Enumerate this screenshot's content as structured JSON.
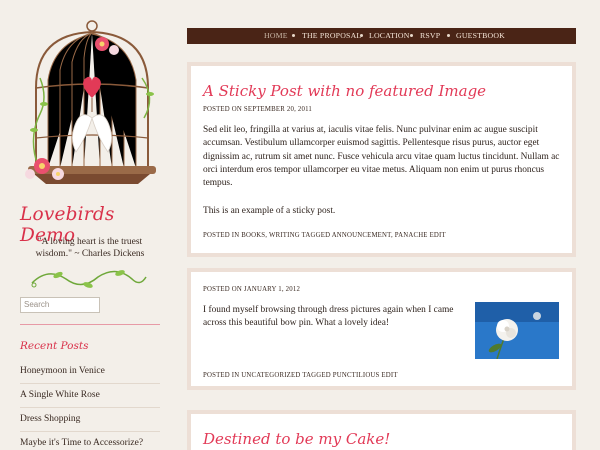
{
  "site": {
    "title": "Lovebirds Demo",
    "tagline": "\"A loving heart is the truest wisdom.\" ~ Charles Dickens"
  },
  "nav": {
    "items": [
      "HOME",
      "THE PROPOSAL",
      "LOCATION",
      "RSVP",
      "GUESTBOOK"
    ]
  },
  "search": {
    "placeholder": "Search"
  },
  "recent": {
    "title": "Recent Posts",
    "items": [
      "Honeymoon in Venice",
      "A Single White Rose",
      "Dress Shopping",
      "Maybe it's Time to Accessorize?"
    ]
  },
  "posts": [
    {
      "title": "A Sticky Post with no featured Image",
      "meta": "POSTED ON SEPTEMBER 20, 2011",
      "lines": [
        "Sed elit leo, fringilla at varius at, iaculis vitae felis. Nunc pulvinar enim ac augue suscipit",
        "accumsan. Vestibulum ullamcorper euismod sagittis. Pellentesque risus purus, auctor eget",
        "dignissim ac, rutrum sit amet nunc. Fusce vehicula arcu vitae quam luctus tincidunt. Nullam ac",
        "orci interdum eros tempor ullamcorper eu vitae metus. Aliquam non enim ut purus rhoncus",
        "tempus."
      ],
      "extra": "This is an example of a sticky post.",
      "footer": "POSTED IN BOOKS, WRITING TAGGED ANNOUNCEMENT, PANACHE EDIT"
    },
    {
      "meta": "POSTED ON JANUARY 1, 2012",
      "lines": [
        "I found myself browsing through dress pictures again when I came",
        "across this beautiful bow pin. What a lovely idea!"
      ],
      "footer": "POSTED IN UNCATEGORIZED TAGGED PUNCTILIOUS EDIT"
    },
    {
      "title": "Destined to be my Cake!"
    }
  ],
  "colors": {
    "accent": "#e23a57",
    "nav_bg": "#4a2416",
    "page_bg": "#f3efe9",
    "post_border": "#eddfd6"
  },
  "icons": [
    "birdcage-illustration",
    "vine-divider",
    "white-rose-thumbnail"
  ]
}
